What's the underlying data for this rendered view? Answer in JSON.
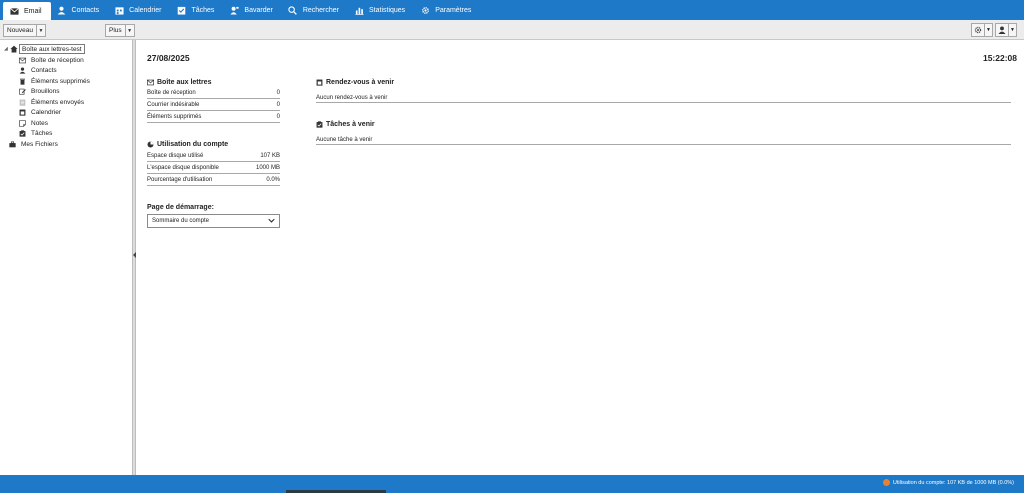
{
  "nav": {
    "items": [
      {
        "label": "Email",
        "icon": "envelope-icon",
        "active": true
      },
      {
        "label": "Contacts",
        "icon": "person-icon"
      },
      {
        "label": "Calendrier",
        "icon": "calendar-icon"
      },
      {
        "label": "Tâches",
        "icon": "tasks-icon"
      },
      {
        "label": "Bavarder",
        "icon": "chat-icon"
      },
      {
        "label": "Rechercher",
        "icon": "search-icon"
      },
      {
        "label": "Statistiques",
        "icon": "bar-chart-icon"
      },
      {
        "label": "Paramètres",
        "icon": "gear-icon"
      }
    ]
  },
  "toolbar": {
    "new_label": "Nouveau",
    "more_label": "Plus"
  },
  "sidebar": {
    "root_label": "Boîte aux lettres-test",
    "items": [
      {
        "label": "Boîte de réception",
        "icon": "inbox-icon"
      },
      {
        "label": "Contacts",
        "icon": "person-icon"
      },
      {
        "label": "Éléments supprimés",
        "icon": "trash-icon"
      },
      {
        "label": "Brouillons",
        "icon": "draft-icon"
      },
      {
        "label": "Éléments envoyés",
        "icon": "sent-icon"
      },
      {
        "label": "Calendrier",
        "icon": "calendar-icon"
      },
      {
        "label": "Notes",
        "icon": "note-icon"
      },
      {
        "label": "Tâches",
        "icon": "tasks-icon"
      }
    ],
    "files_label": "Mes Fichiers"
  },
  "main": {
    "date": "27/08/2025",
    "time": "15:22:08",
    "mailbox": {
      "title": "Boîte aux lettres",
      "rows": [
        {
          "label": "Boîte de réception",
          "value": "0"
        },
        {
          "label": "Courrier indésirable",
          "value": "0"
        },
        {
          "label": "Éléments supprimés",
          "value": "0"
        }
      ]
    },
    "usage": {
      "title": "Utilisation du compte",
      "rows": [
        {
          "label": "Espace disque utilisé",
          "value": "107 KB"
        },
        {
          "label": "L'espace disque disponible",
          "value": "1000 MB"
        },
        {
          "label": "Pourcentage d'utilisation",
          "value": "0.0%"
        }
      ]
    },
    "startup": {
      "title": "Page de démarrage:",
      "selected": "Sommaire du compte"
    },
    "appointments": {
      "title": "Rendez-vous à venir",
      "empty": "Aucun rendez-vous à venir"
    },
    "tasks": {
      "title": "Tâches à venir",
      "empty": "Aucune tâche à venir"
    }
  },
  "status": {
    "usage_text": "Utilisation du compte: 107 KB de 1000 MB (0.0%)"
  },
  "colors": {
    "accent": "#1e79c8",
    "usage_dot": "#e0843a"
  }
}
